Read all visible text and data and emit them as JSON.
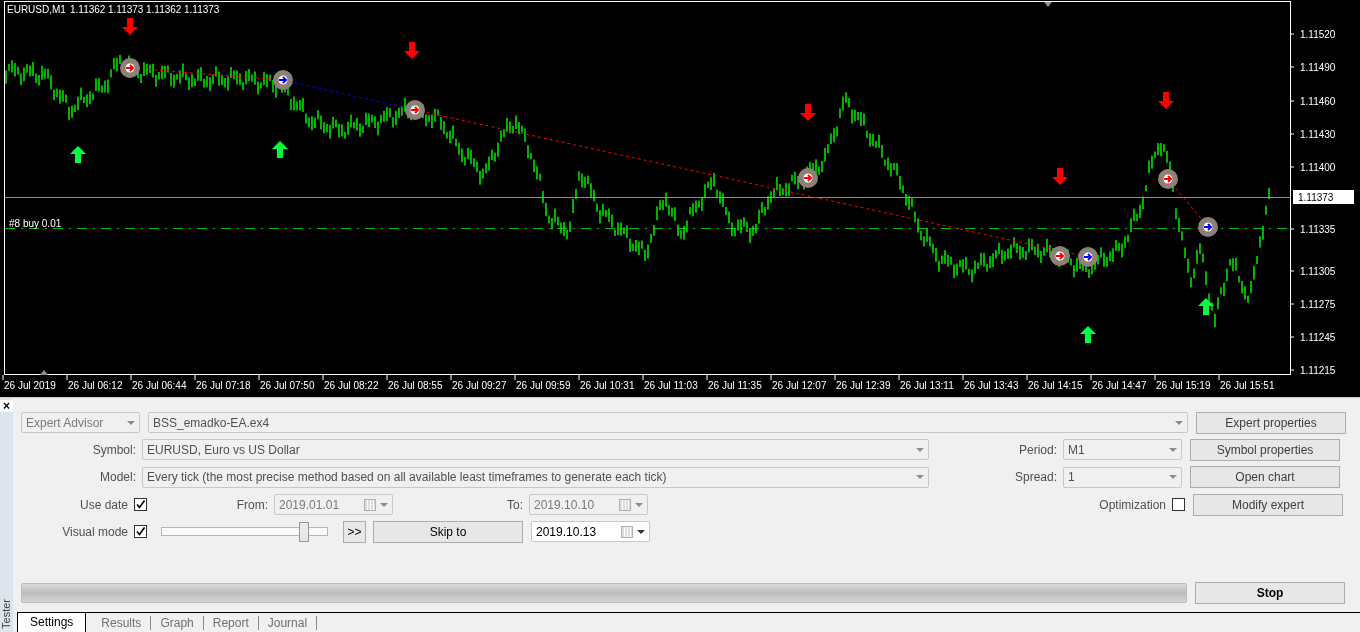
{
  "chart": {
    "symbol": "EURUSD,M1",
    "quotes": [
      "1.11362",
      "1.11373",
      "1.11362",
      "1.11373"
    ],
    "order_label": "#8 buy 0.01",
    "current_price": "1.11373",
    "price_labels": [
      "1.11520",
      "1.11490",
      "1.11460",
      "1.11430",
      "1.11400",
      "1.11335",
      "1.11305",
      "1.11275",
      "1.11245",
      "1.11215"
    ],
    "time_labels": [
      "26 Jul 2019",
      "26 Jul 06:12",
      "26 Jul 06:44",
      "26 Jul 07:18",
      "26 Jul 07:50",
      "26 Jul 08:22",
      "26 Jul 08:55",
      "26 Jul 09:27",
      "26 Jul 09:59",
      "26 Jul 10:31",
      "26 Jul 11:03",
      "26 Jul 11:35",
      "26 Jul 12:07",
      "26 Jul 12:39",
      "26 Jul 13:11",
      "26 Jul 13:43",
      "26 Jul 14:15",
      "26 Jul 14:47",
      "26 Jul 15:19",
      "26 Jul 15:51"
    ]
  },
  "tester": {
    "close": "×",
    "side_label": "Tester",
    "expert_type": "Expert Advisor",
    "expert_file": "BSS_emadko-EA.ex4",
    "symbol": {
      "label": "Symbol:",
      "value": "EURUSD, Euro vs US Dollar"
    },
    "model": {
      "label": "Model:",
      "value": "Every tick (the most precise method based on all available least timeframes to generate each tick)"
    },
    "period": {
      "label": "Period:",
      "value": "M1"
    },
    "spread": {
      "label": "Spread:",
      "value": "1"
    },
    "use_date": {
      "label": "Use date",
      "checked": true
    },
    "from": {
      "label": "From:",
      "value": "2019.01.01"
    },
    "to": {
      "label": "To:",
      "value": "2019.10.10"
    },
    "visual_mode": {
      "label": "Visual mode",
      "checked": true,
      "level": 0.86
    },
    "fast_forward": ">>",
    "skip_to": "Skip to",
    "skip_date": "2019.10.13",
    "optimization": {
      "label": "Optimization",
      "checked": false
    },
    "buttons": [
      "Expert properties",
      "Symbol properties",
      "Open chart",
      "Modify expert"
    ],
    "progress": {
      "level": 1
    },
    "stop": "Stop",
    "tabs": [
      {
        "label": "Settings",
        "selected": true
      },
      {
        "label": "Results",
        "selected": false
      },
      {
        "label": "Graph",
        "selected": false
      },
      {
        "label": "Report",
        "selected": false
      },
      {
        "label": "Journal",
        "selected": false
      }
    ]
  }
}
